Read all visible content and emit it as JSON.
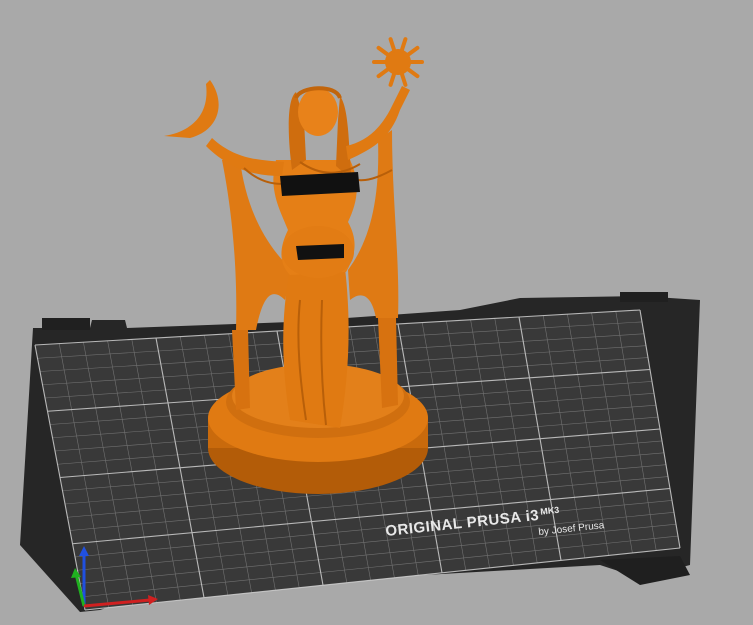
{
  "app": {
    "view": "3D plater viewport"
  },
  "colors": {
    "background": "#a9a9a9",
    "bed_frame": "#2b2b2b",
    "bed_surface": "#3a3a3a",
    "grid_line": "#8c8c8c",
    "grid_line_major": "#cfcfcf",
    "model": "#e07a12",
    "model_shadow": "#b55e08",
    "model_highlight": "#f39a3c",
    "censor_bar": "#111111",
    "axis_x": "#e02020",
    "axis_y": "#20c020",
    "axis_z": "#2050e0"
  },
  "bed": {
    "brand_line1": "ORIGINAL PRUSA i3",
    "brand_mk": "MK3",
    "brand_line2": "by Josef Prusa"
  },
  "icons": {
    "axes": "xyz-axes-icon"
  }
}
